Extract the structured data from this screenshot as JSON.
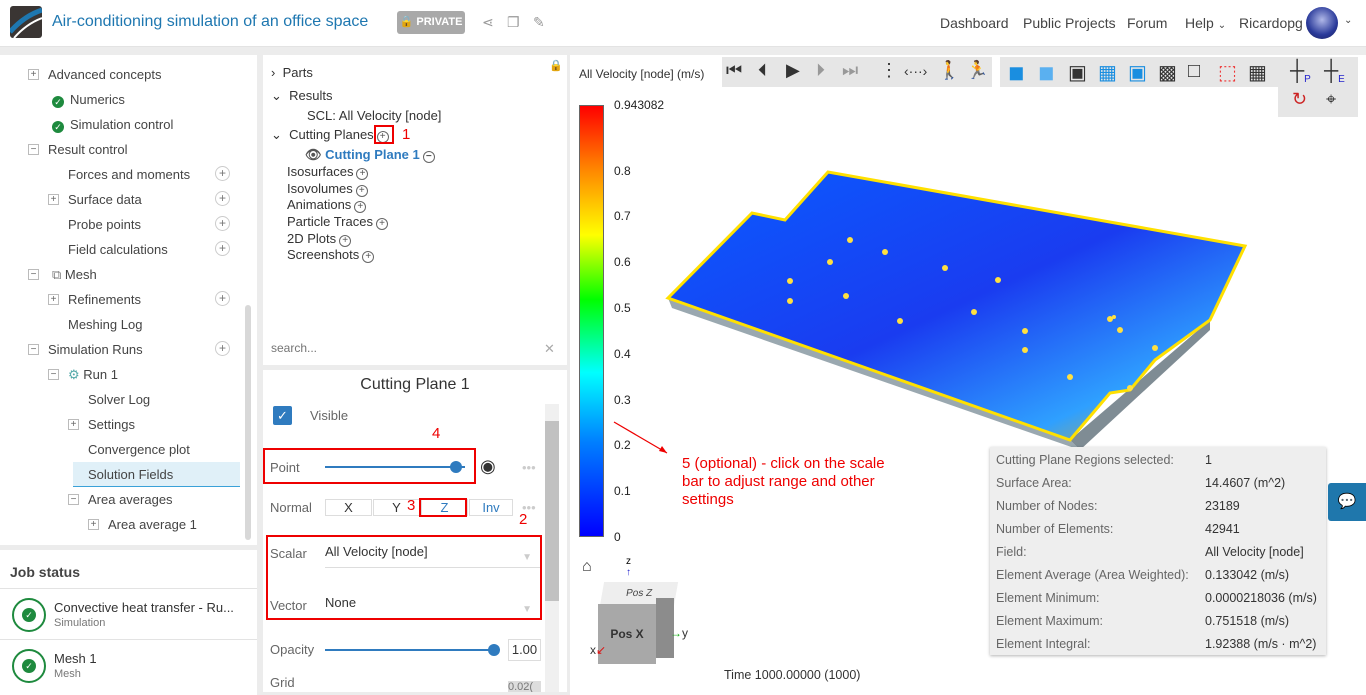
{
  "header": {
    "title": "Air-conditioning simulation of an office space",
    "private_label": "PRIVATE",
    "nav": [
      "Dashboard",
      "Public Projects",
      "Forum",
      "Help",
      "Ricardopg"
    ]
  },
  "tree": {
    "items": [
      {
        "label": "Advanced concepts"
      },
      {
        "label": "Numerics"
      },
      {
        "label": "Simulation control"
      },
      {
        "label": "Result control"
      },
      {
        "label": "Forces and moments"
      },
      {
        "label": "Surface data"
      },
      {
        "label": "Probe points"
      },
      {
        "label": "Field calculations"
      },
      {
        "label": "Mesh"
      },
      {
        "label": "Refinements"
      },
      {
        "label": "Meshing Log"
      },
      {
        "label": "Simulation Runs"
      },
      {
        "label": "Run 1"
      },
      {
        "label": "Solver Log"
      },
      {
        "label": "Settings"
      },
      {
        "label": "Convergence plot"
      },
      {
        "label": "Solution Fields"
      },
      {
        "label": "Area averages"
      },
      {
        "label": "Area average 1"
      }
    ]
  },
  "job_status": {
    "title": "Job status",
    "jobs": [
      {
        "name": "Convective heat transfer - Ru...",
        "type": "Simulation"
      },
      {
        "name": "Mesh 1",
        "type": "Mesh"
      }
    ]
  },
  "post_tree": {
    "parts": "Parts",
    "results": "Results",
    "scl": "SCL: All Velocity [node]",
    "cutting_planes": "Cutting Planes",
    "cutting_plane_1": "Cutting Plane 1",
    "isosurfaces": "Isosurfaces",
    "isovolumes": "Isovolumes",
    "animations": "Animations",
    "particle_traces": "Particle Traces",
    "plots2d": "2D Plots",
    "screenshots": "Screenshots",
    "search_placeholder": "search..."
  },
  "props": {
    "title": "Cutting Plane 1",
    "visible": "Visible",
    "point": "Point",
    "normal": "Normal",
    "normal_options": [
      "X",
      "Y",
      "Z",
      "Inv"
    ],
    "selected_normal": "Z",
    "scalar_label": "Scalar",
    "scalar": "All Velocity [node]",
    "vector_label": "Vector",
    "vector": "None",
    "opacity_label": "Opacity",
    "opacity": "1.00",
    "opacity_fraction": 1.0,
    "point_fraction": 0.93,
    "grid_label": "Grid",
    "grid_value": "0.02("
  },
  "annotations": {
    "a1": "1",
    "a2": "2",
    "a3": "3",
    "a4": "4",
    "a5": "5 (optional) - click on the scale bar to adjust range and other settings"
  },
  "viewer": {
    "field_label": "All Velocity [node] (m/s)",
    "colorbar_max": "0.943082",
    "colorbar_ticks": [
      "0.8",
      "0.7",
      "0.6",
      "0.5",
      "0.4",
      "0.3",
      "0.2",
      "0.1",
      "0"
    ],
    "time": "Time 1000.00000 (1000)",
    "cube_face": "Pos X",
    "cube_top": "Pos Z",
    "axes": [
      "x",
      "y",
      "z"
    ]
  },
  "info": [
    [
      "Cutting Plane Regions selected:",
      "1"
    ],
    [
      "Surface Area:",
      "14.4607 (m^2)"
    ],
    [
      "Number of Nodes:",
      "23189"
    ],
    [
      "Number of Elements:",
      "42941"
    ],
    [
      "Field:",
      "All Velocity [node]"
    ],
    [
      "Element Average (Area Weighted):",
      "0.133042 (m/s)"
    ],
    [
      "Element Minimum:",
      "0.0000218036 (m/s)"
    ],
    [
      "Element Maximum:",
      "0.751518 (m/s)"
    ],
    [
      "Element Integral:",
      "1.92388 (m/s · m^2)"
    ]
  ]
}
